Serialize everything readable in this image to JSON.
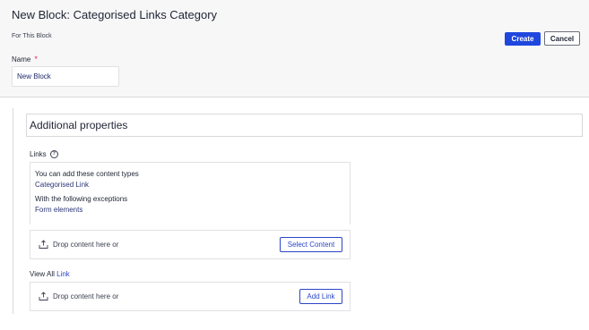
{
  "header": {
    "title": "New Block: Categorised Links Category",
    "subtitle": "For This Block",
    "name_label": "Name",
    "required_mark": "*",
    "name_value": "New Block",
    "create_label": "Create",
    "cancel_label": "Cancel"
  },
  "section": {
    "title": "Additional properties"
  },
  "links": {
    "label": "Links",
    "help_icon": "?",
    "allowed_heading": "You can add these content types",
    "allowed_value": "Categorised Link",
    "exceptions_heading": "With the following exceptions",
    "exceptions_value": "Form elements",
    "drop_text": "Drop content here or",
    "select_button": "Select Content"
  },
  "view_all": {
    "label_prefix": "View All",
    "label_link": "Link",
    "drop_text": "Drop content here or",
    "add_button": "Add Link"
  },
  "icons": {
    "drop": "upload-tray-icon",
    "help": "help-circle-icon"
  },
  "colors": {
    "primary": "#1f47de",
    "outline_accent": "#2b46c6",
    "required": "#e0245e",
    "header_bg": "#f7f7f8"
  }
}
